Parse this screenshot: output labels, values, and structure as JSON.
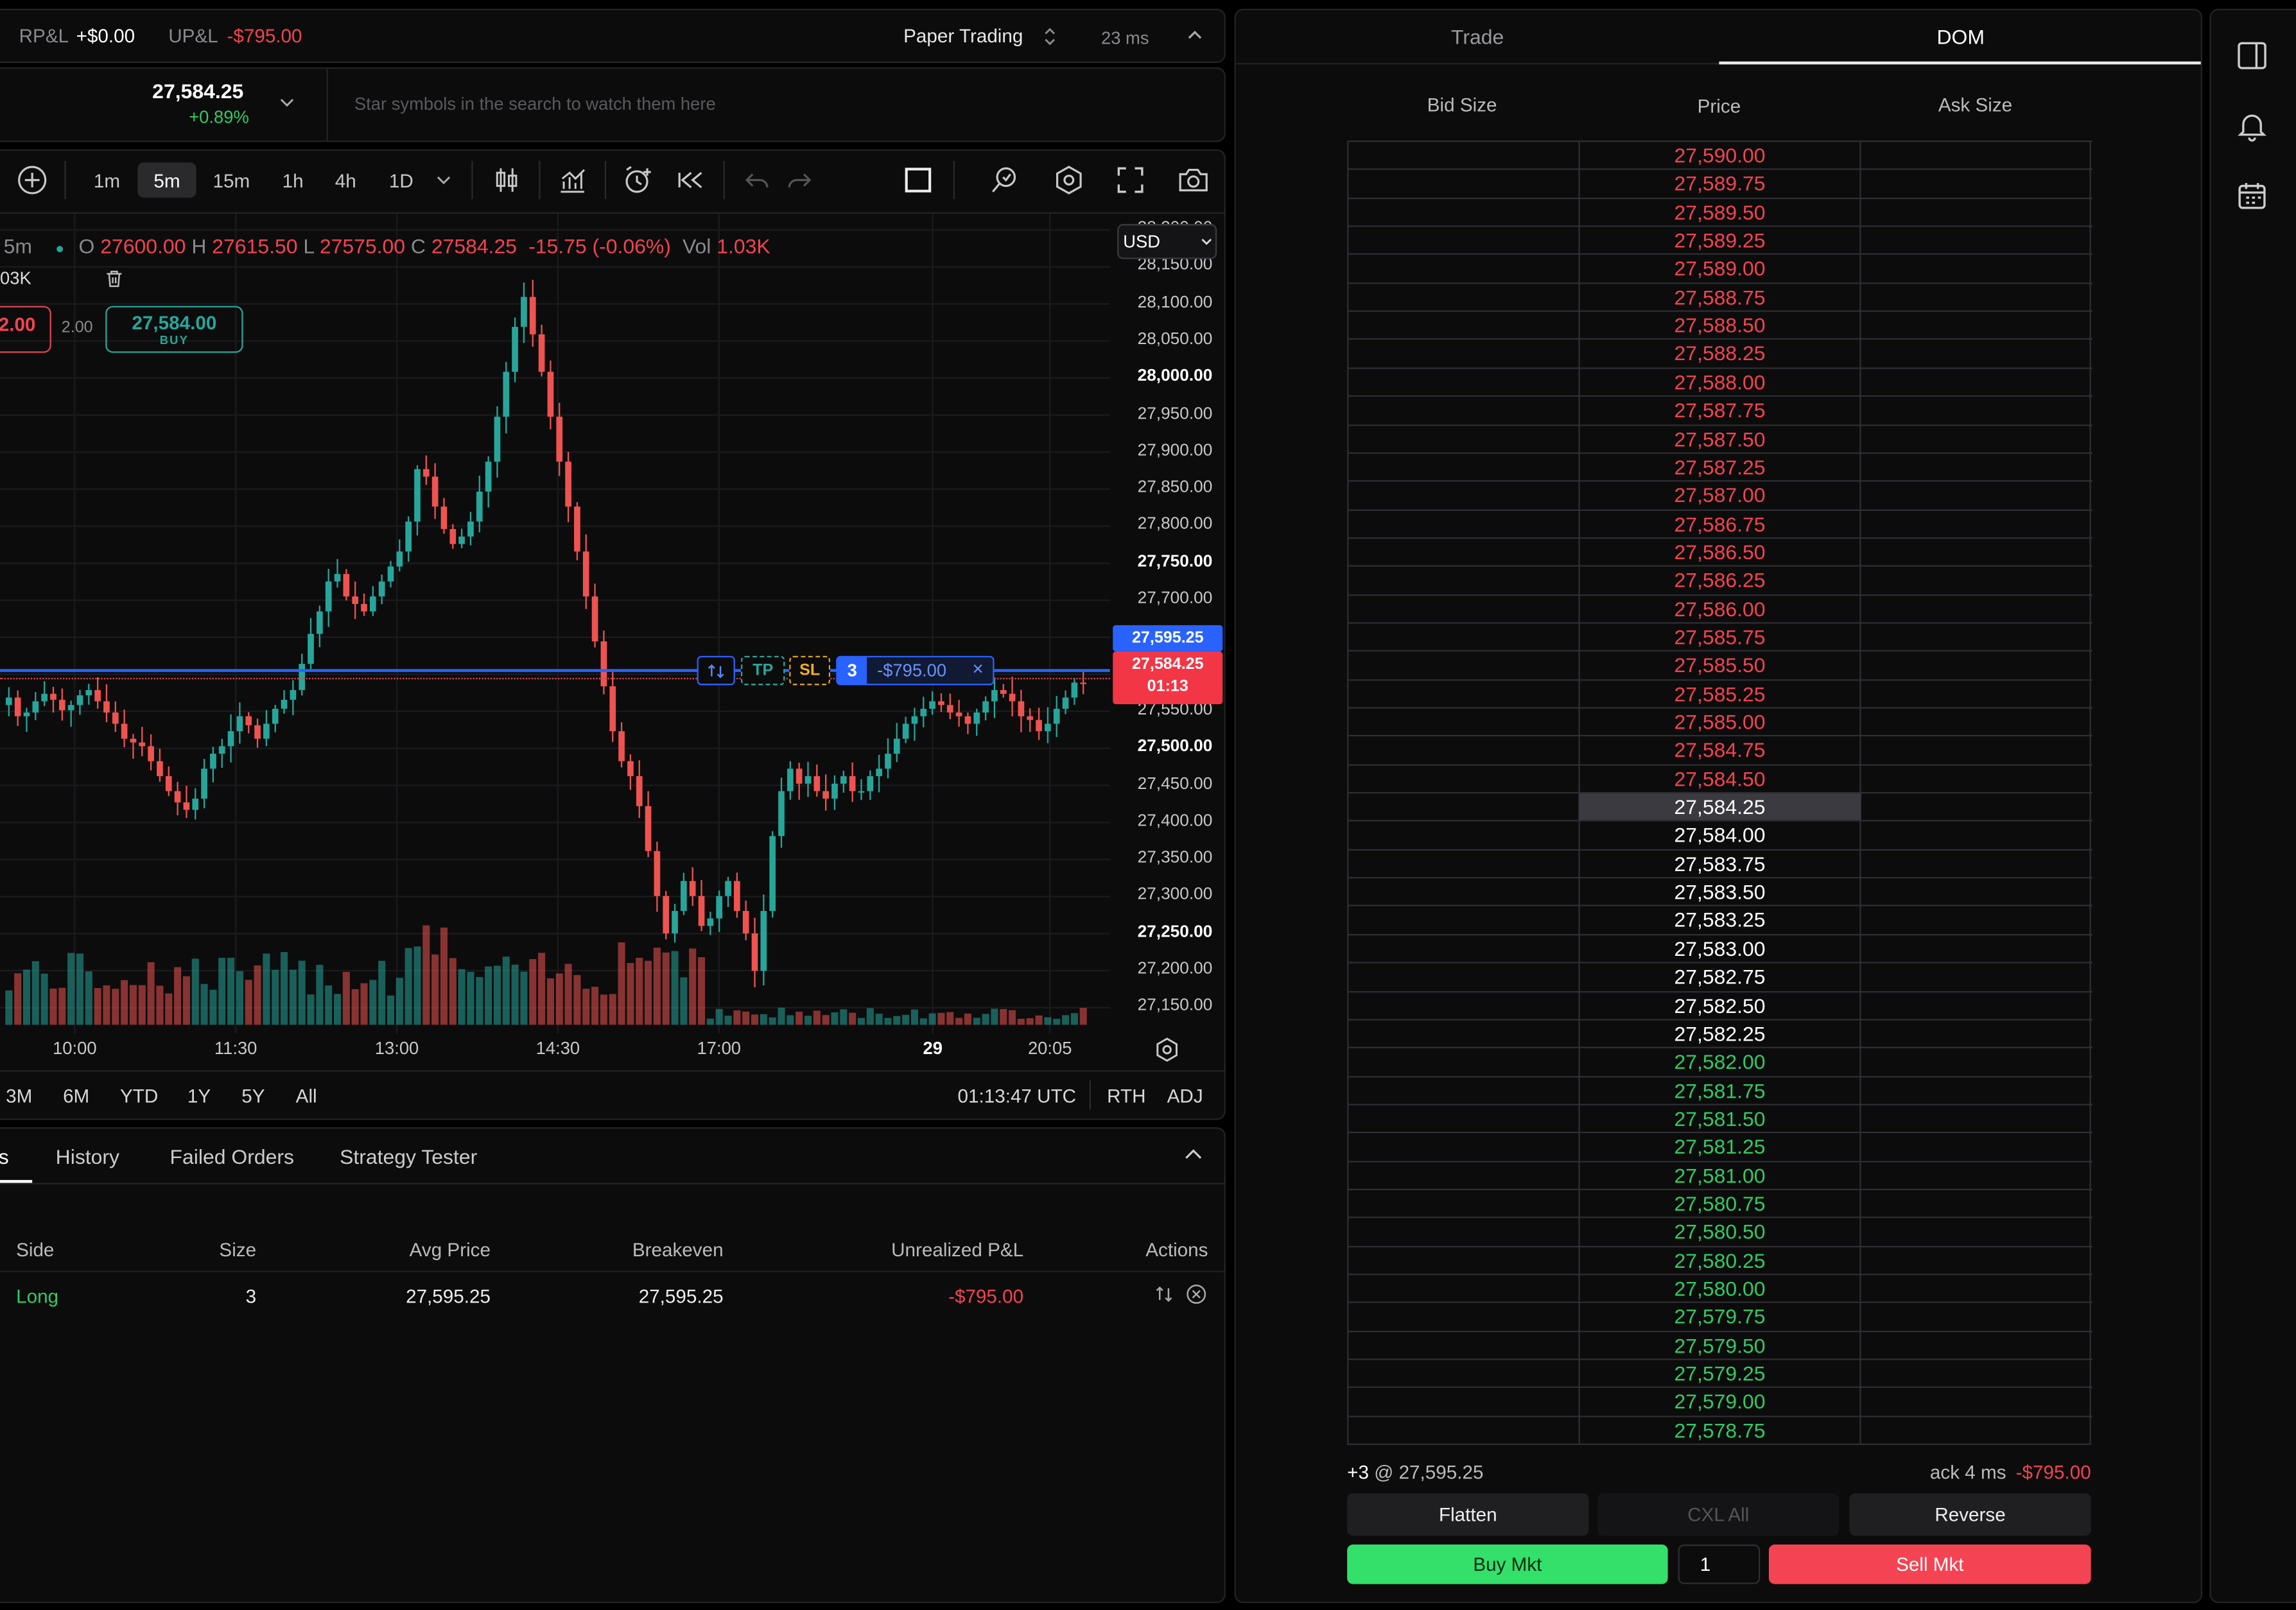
{
  "topbar": {
    "rpl_label": "RP&L",
    "rpl_value": "+$0.00",
    "upl_label": "UP&L",
    "upl_value": "-$795.00",
    "mode": "Paper Trading",
    "latency": "23 ms"
  },
  "watch": {
    "price": "27,584.25",
    "change": "+0.89%",
    "placeholder": "Star symbols in the search to watch them here"
  },
  "toolbar": {
    "intervals": [
      "1m",
      "5m",
      "15m",
      "1h",
      "4h",
      "1D"
    ],
    "active_interval": "5m"
  },
  "legend": {
    "interval": "5m",
    "o_label": "O",
    "o": "27600.00",
    "h_label": "H",
    "h": "27615.50",
    "l_label": "L",
    "l": "27575.00",
    "c_label": "C",
    "c": "27584.25",
    "change": "-15.75 (-0.06%)",
    "vol_label": "Vol",
    "vol": "1.03K",
    "vol_sub": "03K",
    "sell_price": "2.00",
    "spread": "2.00",
    "buy_price": "27,584.00",
    "buy_label": "BUY",
    "currency": "USD"
  },
  "price_axis": [
    {
      "v": "28,200.00",
      "b": false
    },
    {
      "v": "28,150.00",
      "b": false
    },
    {
      "v": "28,100.00",
      "b": false
    },
    {
      "v": "28,050.00",
      "b": false
    },
    {
      "v": "28,000.00",
      "b": true
    },
    {
      "v": "27,950.00",
      "b": false
    },
    {
      "v": "27,900.00",
      "b": false
    },
    {
      "v": "27,850.00",
      "b": false
    },
    {
      "v": "27,800.00",
      "b": false
    },
    {
      "v": "27,750.00",
      "b": true
    },
    {
      "v": "27,700.00",
      "b": false
    },
    {
      "v": "27,650.00",
      "b": false
    },
    {
      "v": "27,600.00",
      "b": false
    },
    {
      "v": "27,550.00",
      "b": false
    },
    {
      "v": "27,500.00",
      "b": true
    },
    {
      "v": "27,450.00",
      "b": false
    },
    {
      "v": "27,400.00",
      "b": false
    },
    {
      "v": "27,350.00",
      "b": false
    },
    {
      "v": "27,300.00",
      "b": false
    },
    {
      "v": "27,250.00",
      "b": true
    },
    {
      "v": "27,200.00",
      "b": false
    },
    {
      "v": "27,150.00",
      "b": false
    }
  ],
  "price_tags": {
    "position": "27,595.25",
    "last": "27,584.25",
    "countdown": "01:13"
  },
  "position_line": {
    "tp": "TP",
    "sl": "SL",
    "qty": "3",
    "pnl": "-$795.00",
    "close": "×"
  },
  "time_axis": [
    "10:00",
    "11:30",
    "13:00",
    "14:30",
    "17:00",
    "29",
    "20:05"
  ],
  "ranges": [
    "3M",
    "6M",
    "YTD",
    "1Y",
    "5Y",
    "All"
  ],
  "clock": "01:13:47 UTC",
  "session": {
    "rth": "RTH",
    "adj": "ADJ"
  },
  "bottom_tabs": [
    "s",
    "History",
    "Failed Orders",
    "Strategy Tester"
  ],
  "positions": {
    "headers": [
      "Side",
      "Size",
      "Avg Price",
      "Breakeven",
      "Unrealized P&L",
      "Actions"
    ],
    "rows": [
      {
        "side": "Long",
        "size": "3",
        "avg": "27,595.25",
        "breakeven": "27,595.25",
        "upl": "-$795.00"
      }
    ]
  },
  "right_tabs": [
    "Trade",
    "DOM"
  ],
  "dom": {
    "headers": [
      "Bid Size",
      "Price",
      "Ask Size"
    ],
    "prices": [
      "27,590.00",
      "27,589.75",
      "27,589.50",
      "27,589.25",
      "27,589.00",
      "27,588.75",
      "27,588.50",
      "27,588.25",
      "27,588.00",
      "27,587.75",
      "27,587.50",
      "27,587.25",
      "27,587.00",
      "27,586.75",
      "27,586.50",
      "27,586.25",
      "27,586.00",
      "27,585.75",
      "27,585.50",
      "27,585.25",
      "27,585.00",
      "27,584.75",
      "27,584.50",
      "27,584.25",
      "27,584.00",
      "27,583.75",
      "27,583.50",
      "27,583.25",
      "27,583.00",
      "27,582.75",
      "27,582.50",
      "27,582.25",
      "27,582.00",
      "27,581.75",
      "27,581.50",
      "27,581.25",
      "27,581.00",
      "27,580.75",
      "27,580.50",
      "27,580.25",
      "27,580.00",
      "27,579.75",
      "27,579.50",
      "27,579.25",
      "27,579.00",
      "27,578.75"
    ],
    "position": "+3",
    "position_at": "@ 27,595.25",
    "ack": "ack 4 ms",
    "pnl": "-$795.00",
    "flatten": "Flatten",
    "cxl_all": "CXL All",
    "reverse": "Reverse",
    "buy_mkt": "Buy Mkt",
    "qty": "1",
    "sell_mkt": "Sell Mkt"
  },
  "colors": {
    "up": "#26a69a",
    "down": "#ef5350",
    "buy": "#33e06a",
    "sell": "#f4434f",
    "accent": "#2962ff"
  }
}
